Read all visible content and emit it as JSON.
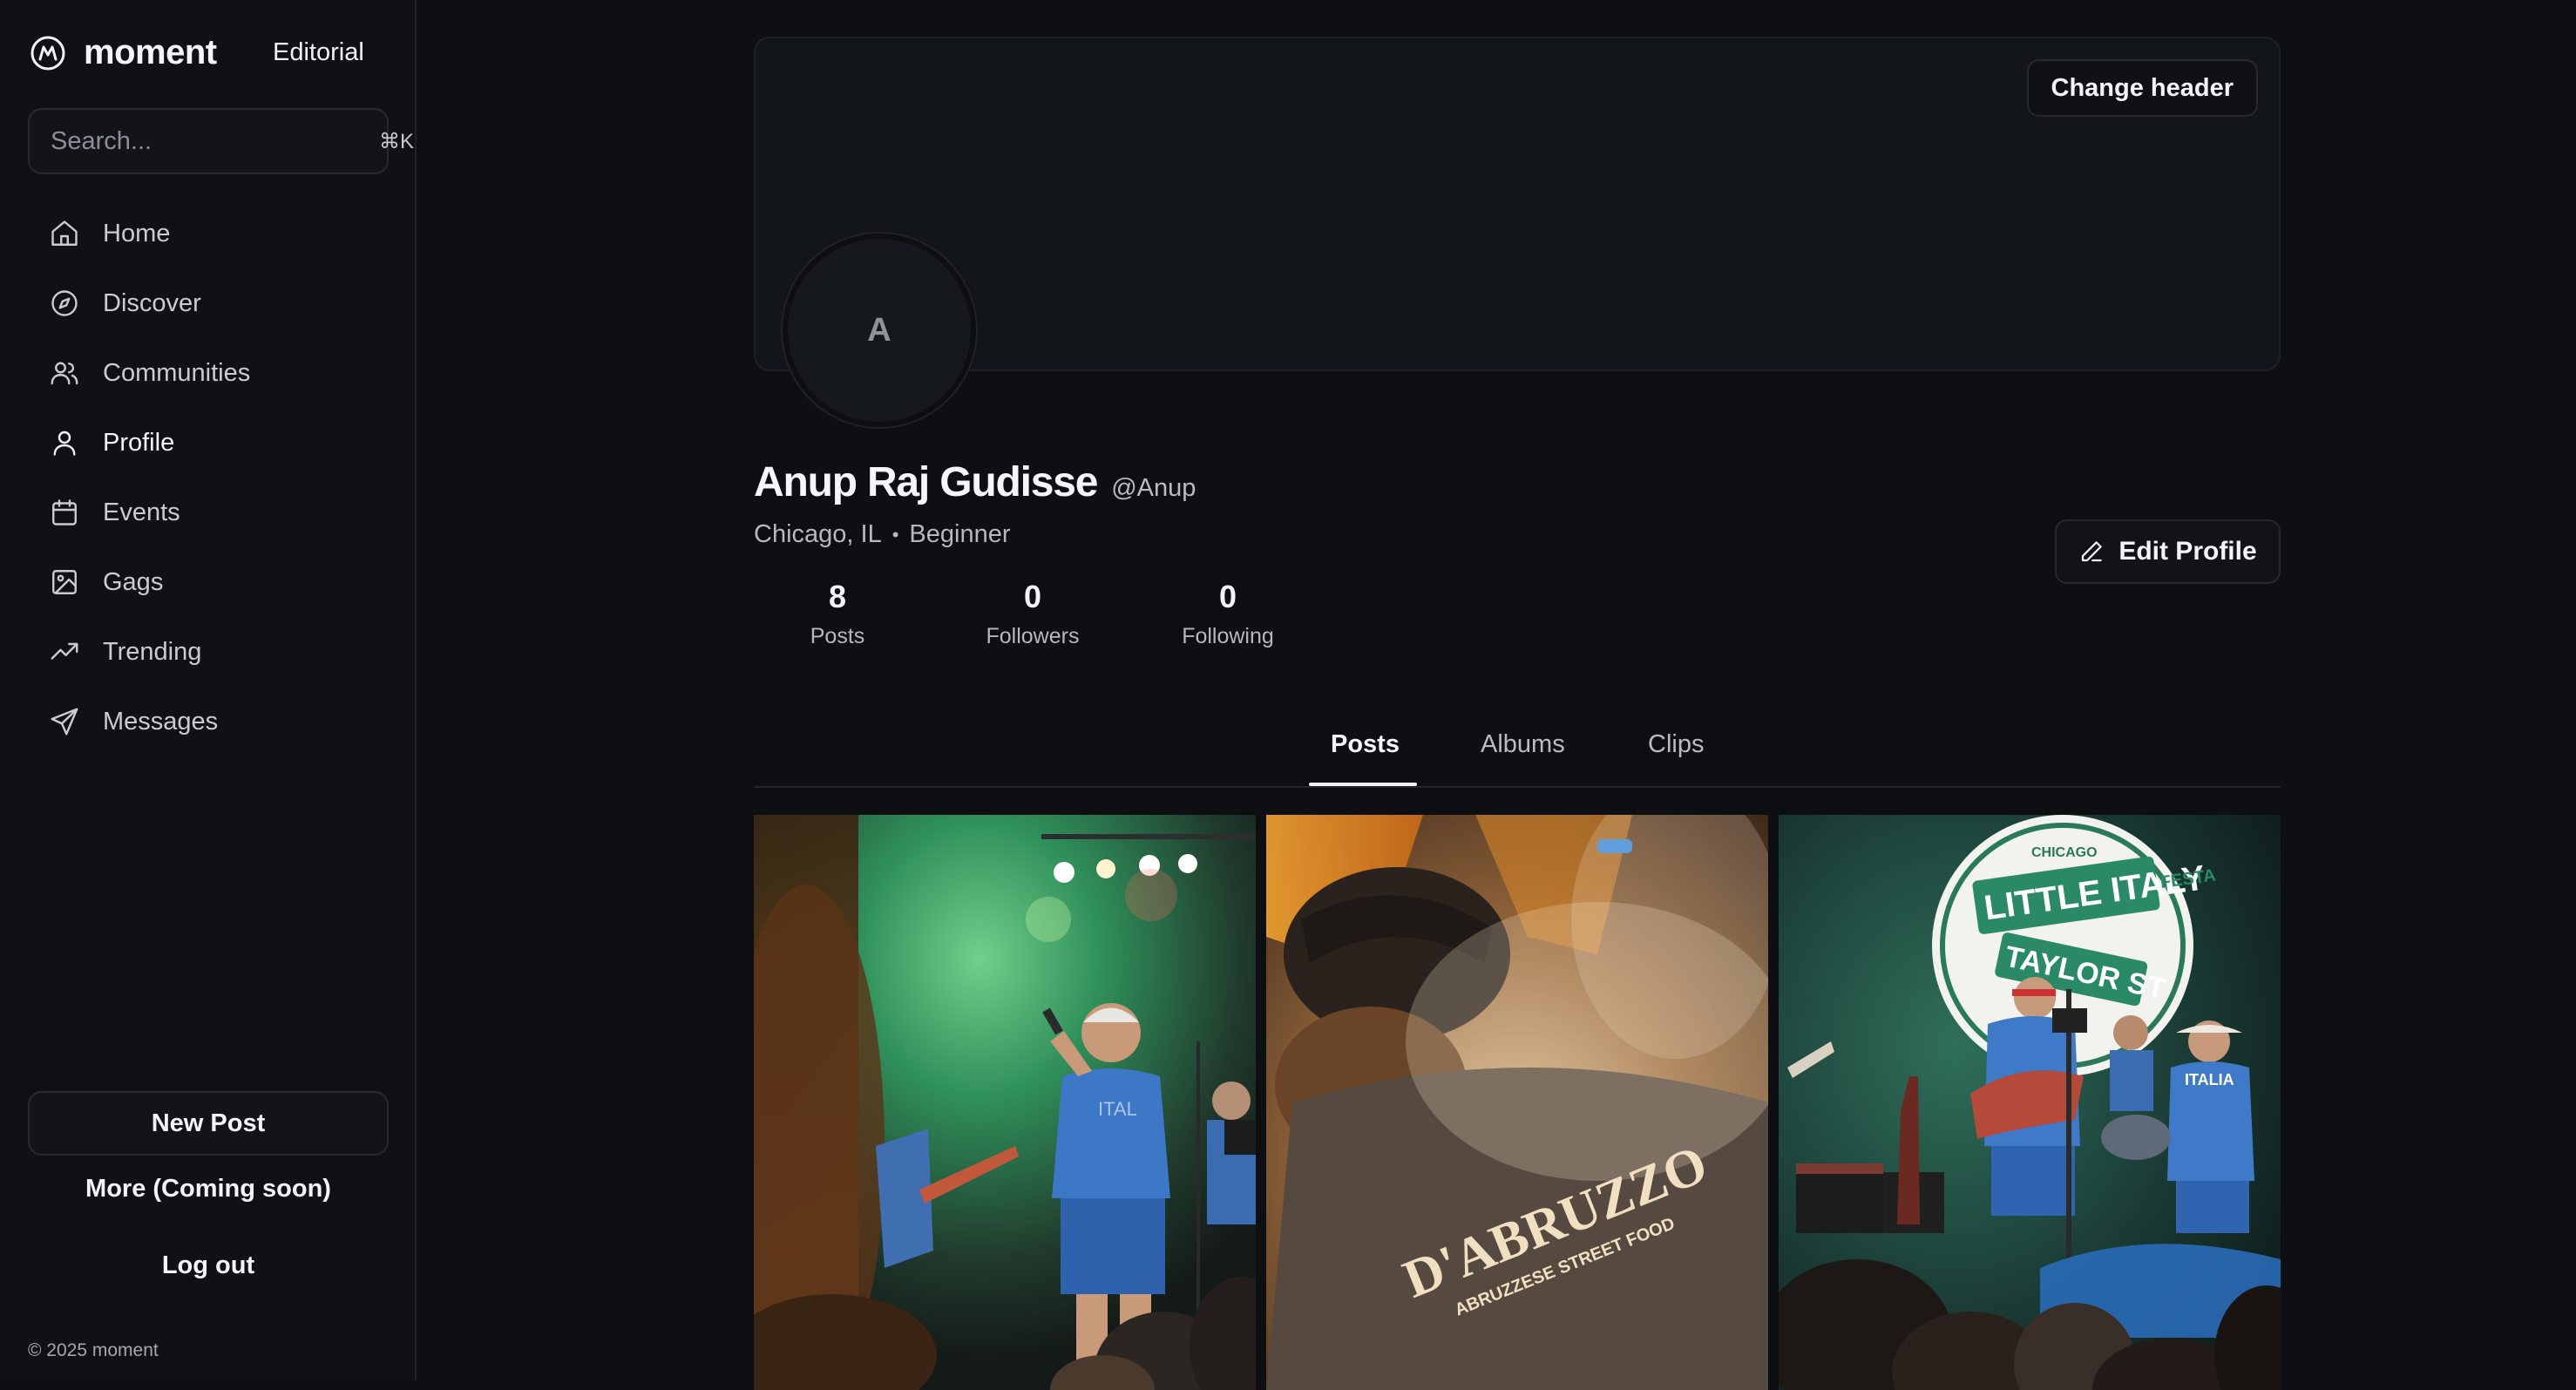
{
  "sidebar": {
    "brand": "moment",
    "editorial": "Editorial",
    "search": {
      "placeholder": "Search...",
      "shortcut": "⌘K"
    },
    "nav": [
      {
        "label": "Home",
        "icon": "home-icon"
      },
      {
        "label": "Discover",
        "icon": "compass-icon"
      },
      {
        "label": "Communities",
        "icon": "users-icon"
      },
      {
        "label": "Profile",
        "icon": "user-icon",
        "active": true
      },
      {
        "label": "Events",
        "icon": "calendar-icon"
      },
      {
        "label": "Gags",
        "icon": "image-icon"
      },
      {
        "label": "Trending",
        "icon": "trending-icon"
      },
      {
        "label": "Messages",
        "icon": "send-icon"
      }
    ],
    "new_post": "New Post",
    "more": "More (Coming soon)",
    "logout": "Log out",
    "copyright": "© 2025 moment"
  },
  "profile": {
    "change_header": "Change header",
    "avatar_initial": "A",
    "name": "Anup Raj Gudisse",
    "handle": "@Anup",
    "location": "Chicago, IL",
    "separator": "•",
    "level": "Beginner",
    "edit_profile": "Edit Profile",
    "stats": [
      {
        "value": "8",
        "label": "Posts"
      },
      {
        "value": "0",
        "label": "Followers"
      },
      {
        "value": "0",
        "label": "Following"
      }
    ]
  },
  "tabs": [
    {
      "label": "Posts",
      "active": true
    },
    {
      "label": "Albums"
    },
    {
      "label": "Clips"
    }
  ],
  "posts": {
    "tile_2_text": "D'ABRUZZO",
    "tile_2_subtext": "ABRUZZESE STREET FOOD",
    "tile_3_sign_top": "CHICAGO",
    "tile_3_sign_main": "LITTLE ITALY",
    "tile_3_sign_side": "FESTA",
    "tile_3_sign_street": "TAYLOR ST",
    "tile_3_shirt": "ITALIA"
  },
  "colors": {
    "background": "#0d0f12",
    "sidebar": "#0f1114",
    "border": "#262a30",
    "text": "#f3f4f6",
    "muted": "#b4b8bf"
  }
}
